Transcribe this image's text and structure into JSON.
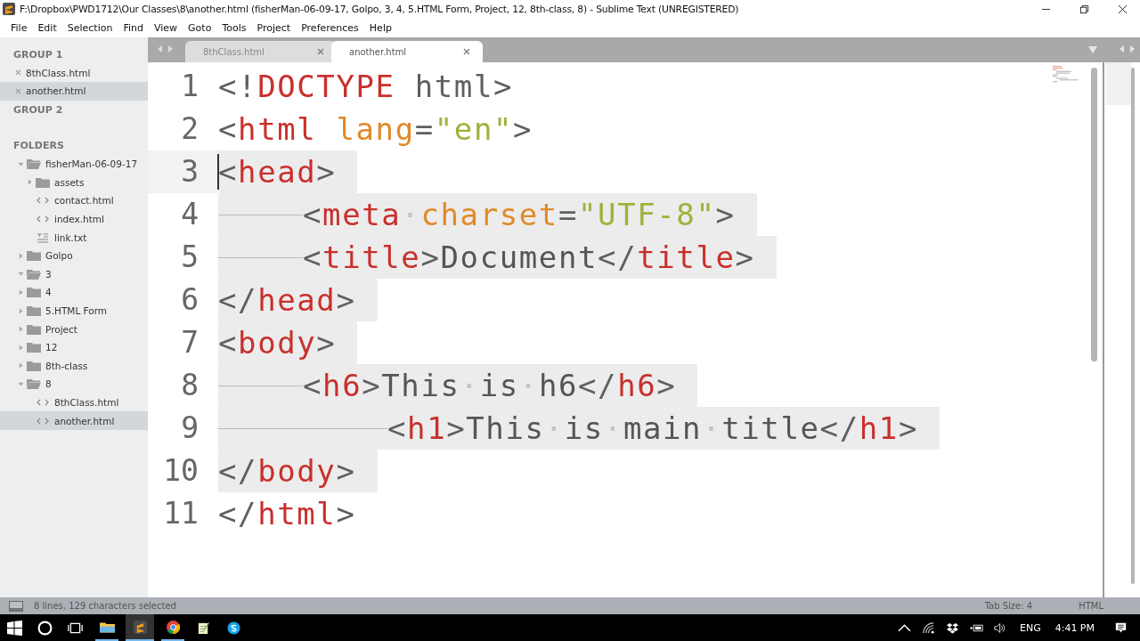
{
  "window": {
    "title": "F:\\Dropbox\\PWD1712\\Our Classes\\8\\another.html (fisherMan-06-09-17, Golpo, 3, 4, 5.HTML Form, Project, 12, 8th-class, 8) - Sublime Text (UNREGISTERED)"
  },
  "menu": [
    "File",
    "Edit",
    "Selection",
    "Find",
    "View",
    "Goto",
    "Tools",
    "Project",
    "Preferences",
    "Help"
  ],
  "sidebar": {
    "groups": [
      {
        "title": "GROUP 1",
        "files": [
          {
            "name": "8thClass.html",
            "selected": false
          },
          {
            "name": "another.html",
            "selected": true
          }
        ]
      },
      {
        "title": "GROUP 2"
      }
    ],
    "folders_title": "FOLDERS",
    "tree": [
      {
        "name": "fisherMan-06-09-17",
        "kind": "folder",
        "expanded": true,
        "selected": false,
        "children": [
          {
            "name": "assets",
            "kind": "folder",
            "expanded": false,
            "selected": false
          },
          {
            "name": "contact.html",
            "kind": "html",
            "selected": false
          },
          {
            "name": "index.html",
            "kind": "html",
            "selected": false
          },
          {
            "name": "link.txt",
            "kind": "text",
            "selected": false
          }
        ]
      },
      {
        "name": "Golpo",
        "kind": "folder",
        "expanded": false,
        "selected": false
      },
      {
        "name": "3",
        "kind": "folder",
        "expanded": true,
        "selected": false
      },
      {
        "name": "4",
        "kind": "folder",
        "expanded": false,
        "selected": false
      },
      {
        "name": "5.HTML Form",
        "kind": "folder",
        "expanded": false,
        "selected": false
      },
      {
        "name": "Project",
        "kind": "folder",
        "expanded": false,
        "selected": false
      },
      {
        "name": "12",
        "kind": "folder",
        "expanded": false,
        "selected": false
      },
      {
        "name": "8th-class",
        "kind": "folder",
        "expanded": false,
        "selected": false
      },
      {
        "name": "8",
        "kind": "folder",
        "expanded": true,
        "selected": false,
        "children": [
          {
            "name": "8thClass.html",
            "kind": "html",
            "selected": false
          },
          {
            "name": "another.html",
            "kind": "html",
            "selected": true
          }
        ]
      }
    ]
  },
  "tabs": [
    {
      "label": "8thClass.html",
      "selected": false
    },
    {
      "label": "another.html",
      "selected": true
    }
  ],
  "editor": {
    "lines": [
      {
        "number": "1",
        "selected": false,
        "current": false,
        "tokens": [
          {
            "text": "<!",
            "kind": "punct"
          },
          {
            "text": "DOCTYPE",
            "kind": "tag"
          },
          {
            "text": " html>",
            "kind": "punct"
          }
        ]
      },
      {
        "number": "2",
        "selected": false,
        "current": false,
        "tokens": [
          {
            "text": "<",
            "kind": "punct"
          },
          {
            "text": "html",
            "kind": "tag"
          },
          {
            "text": " lang",
            "kind": "attr"
          },
          {
            "text": "=",
            "kind": "punct"
          },
          {
            "text": "\"en\"",
            "kind": "string"
          },
          {
            "text": ">",
            "kind": "punct"
          }
        ]
      },
      {
        "number": "3",
        "selected": true,
        "current": true,
        "tokens": [
          {
            "text": "<",
            "kind": "punct"
          },
          {
            "text": "head",
            "kind": "tag"
          },
          {
            "text": ">",
            "kind": "punct"
          }
        ]
      },
      {
        "number": "4",
        "selected": true,
        "current": false,
        "tokens": [
          {
            "kind": "tab"
          },
          {
            "text": "<",
            "kind": "punct"
          },
          {
            "text": "meta",
            "kind": "tag"
          },
          {
            "text": "·",
            "kind": "ws"
          },
          {
            "text": "charset",
            "kind": "attr"
          },
          {
            "text": "=",
            "kind": "punct"
          },
          {
            "text": "\"UTF-8\"",
            "kind": "string"
          },
          {
            "text": ">",
            "kind": "punct"
          }
        ]
      },
      {
        "number": "5",
        "selected": true,
        "current": false,
        "tokens": [
          {
            "kind": "tab"
          },
          {
            "text": "<",
            "kind": "punct"
          },
          {
            "text": "title",
            "kind": "tag"
          },
          {
            "text": ">",
            "kind": "punct"
          },
          {
            "text": "Document",
            "kind": "text"
          },
          {
            "text": "</",
            "kind": "punct"
          },
          {
            "text": "title",
            "kind": "tag"
          },
          {
            "text": ">",
            "kind": "punct"
          }
        ]
      },
      {
        "number": "6",
        "selected": true,
        "current": false,
        "tokens": [
          {
            "text": "</",
            "kind": "punct"
          },
          {
            "text": "head",
            "kind": "tag"
          },
          {
            "text": ">",
            "kind": "punct"
          }
        ]
      },
      {
        "number": "7",
        "selected": true,
        "current": false,
        "tokens": [
          {
            "text": "<",
            "kind": "punct"
          },
          {
            "text": "body",
            "kind": "tag"
          },
          {
            "text": ">",
            "kind": "punct"
          }
        ]
      },
      {
        "number": "8",
        "selected": true,
        "current": false,
        "tokens": [
          {
            "kind": "tab"
          },
          {
            "text": "<",
            "kind": "punct"
          },
          {
            "text": "h6",
            "kind": "tag"
          },
          {
            "text": ">",
            "kind": "punct"
          },
          {
            "text": "This",
            "kind": "text"
          },
          {
            "text": "·",
            "kind": "ws"
          },
          {
            "text": "is",
            "kind": "text"
          },
          {
            "text": "·",
            "kind": "ws"
          },
          {
            "text": "h6",
            "kind": "text"
          },
          {
            "text": "</",
            "kind": "punct"
          },
          {
            "text": "h6",
            "kind": "tag"
          },
          {
            "text": ">",
            "kind": "punct"
          }
        ]
      },
      {
        "number": "9",
        "selected": true,
        "current": false,
        "tokens": [
          {
            "kind": "tab"
          },
          {
            "kind": "tab"
          },
          {
            "text": "<",
            "kind": "punct"
          },
          {
            "text": "h1",
            "kind": "tag"
          },
          {
            "text": ">",
            "kind": "punct"
          },
          {
            "text": "This",
            "kind": "text"
          },
          {
            "text": "·",
            "kind": "ws"
          },
          {
            "text": "is",
            "kind": "text"
          },
          {
            "text": "·",
            "kind": "ws"
          },
          {
            "text": "main",
            "kind": "text"
          },
          {
            "text": "·",
            "kind": "ws"
          },
          {
            "text": "title",
            "kind": "text"
          },
          {
            "text": "</",
            "kind": "punct"
          },
          {
            "text": "h1",
            "kind": "tag"
          },
          {
            "text": ">",
            "kind": "punct"
          }
        ]
      },
      {
        "number": "10",
        "selected": true,
        "current": false,
        "tokens": [
          {
            "text": "</",
            "kind": "punct"
          },
          {
            "text": "body",
            "kind": "tag"
          },
          {
            "text": ">",
            "kind": "punct"
          }
        ]
      },
      {
        "number": "11",
        "selected": false,
        "current": false,
        "tokens": [
          {
            "text": "</",
            "kind": "punct"
          },
          {
            "text": "html",
            "kind": "tag"
          },
          {
            "text": ">",
            "kind": "punct"
          }
        ]
      }
    ]
  },
  "status_bar": {
    "message": "8 lines, 129 characters selected",
    "tab_size": "Tab Size: 4",
    "syntax": "HTML"
  },
  "taskbar": {
    "apps": [
      {
        "kind": "explorer",
        "running": true,
        "active": false
      },
      {
        "kind": "sublime",
        "running": true,
        "active": true
      },
      {
        "kind": "chrome",
        "running": true,
        "active": false
      },
      {
        "kind": "notepad",
        "running": false,
        "active": false
      },
      {
        "kind": "skype",
        "running": false,
        "active": false
      }
    ],
    "language": "ENG",
    "time": "4:41 PM"
  }
}
